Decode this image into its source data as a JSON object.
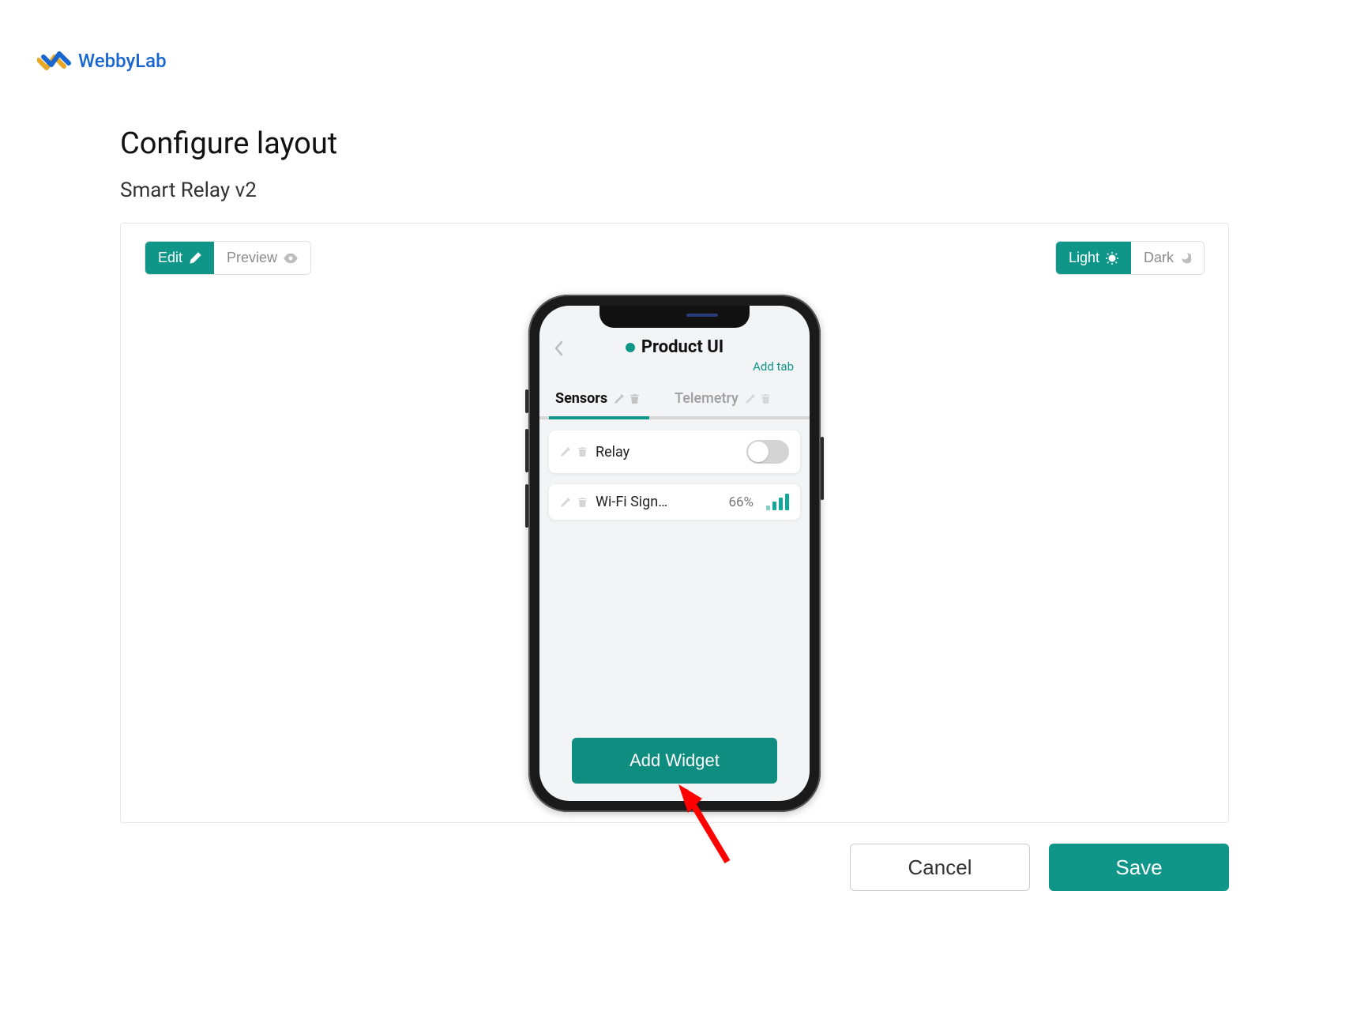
{
  "brand": {
    "name": "WebbyLab"
  },
  "page": {
    "title": "Configure layout",
    "subtitle": "Smart Relay v2"
  },
  "mode_toggle": {
    "edit": "Edit",
    "preview": "Preview"
  },
  "theme_toggle": {
    "light": "Light",
    "dark": "Dark"
  },
  "phone": {
    "app_title": "Product UI",
    "add_tab": "Add tab",
    "tabs": [
      {
        "label": "Sensors",
        "active": true
      },
      {
        "label": "Telemetry",
        "active": false
      }
    ],
    "widgets": [
      {
        "label": "Relay",
        "type": "switch"
      },
      {
        "label": "Wi-Fi Sign…",
        "type": "signal",
        "value": "66%"
      }
    ],
    "add_widget": "Add Widget"
  },
  "footer": {
    "cancel": "Cancel",
    "save": "Save"
  }
}
